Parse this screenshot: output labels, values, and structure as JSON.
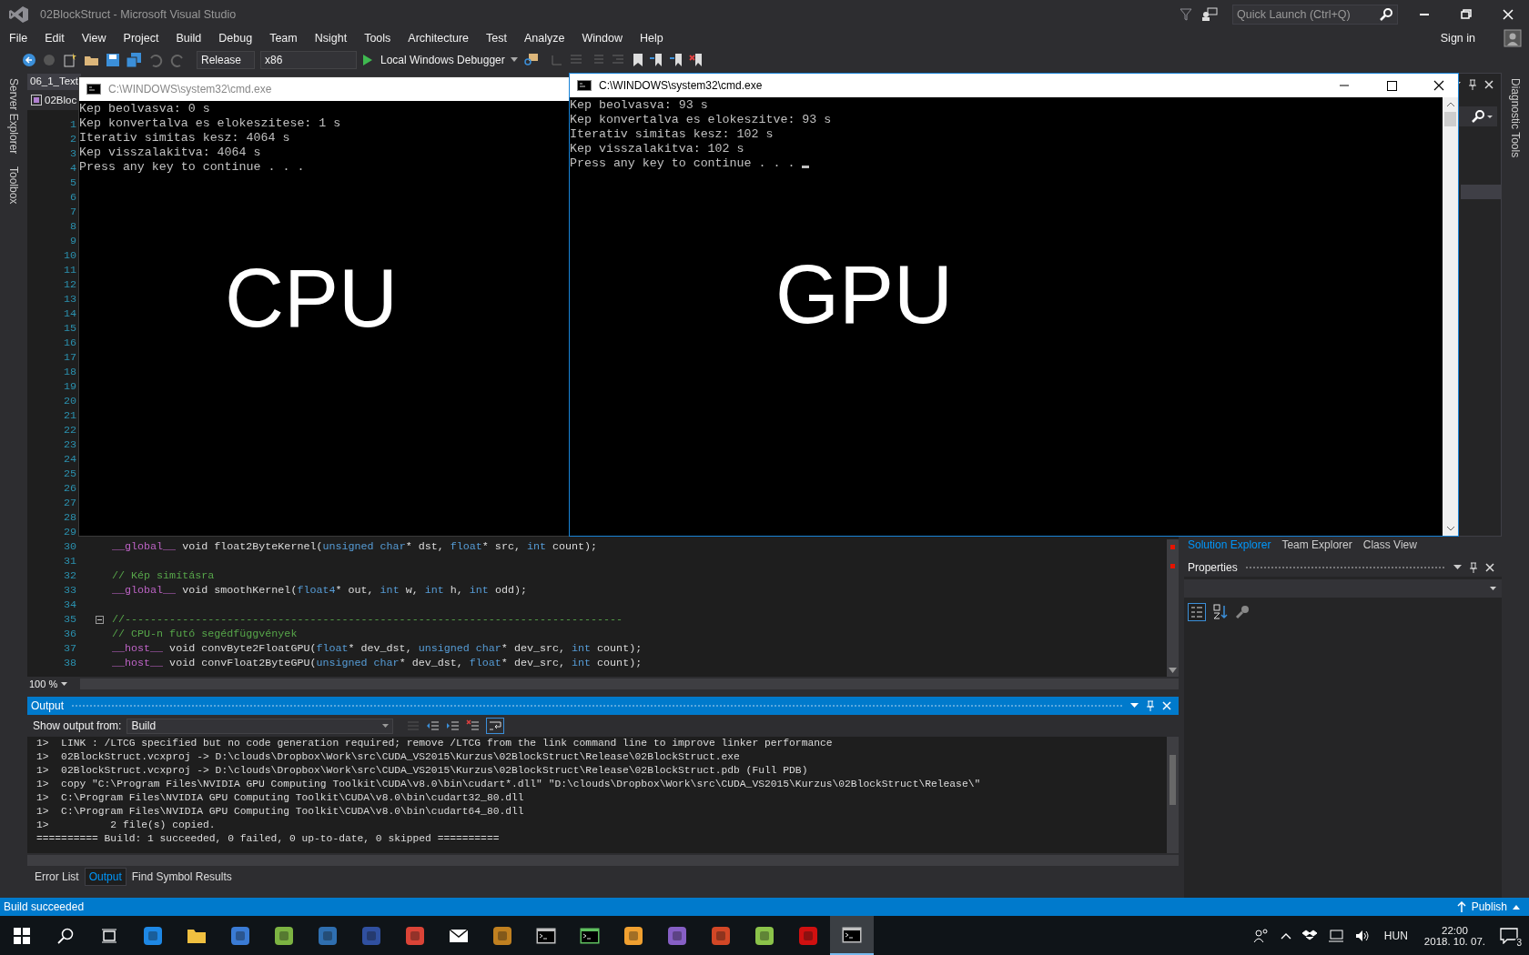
{
  "window": {
    "title": "02BlockStruct - Microsoft Visual Studio"
  },
  "quick_launch": {
    "placeholder": "Quick Launch (Ctrl+Q)"
  },
  "sign_in": "Sign in",
  "menu": [
    "File",
    "Edit",
    "View",
    "Project",
    "Build",
    "Debug",
    "Team",
    "Nsight",
    "Tools",
    "Architecture",
    "Test",
    "Analyze",
    "Window",
    "Help"
  ],
  "toolbar": {
    "configuration": "Release",
    "platform": "x86",
    "debugger": "Local Windows Debugger"
  },
  "left_strip": [
    "Server Explorer",
    "Toolbox"
  ],
  "right_strip": [
    "Diagnostic Tools"
  ],
  "editor": {
    "tab": "06_1_Text",
    "scope": "02Bloc",
    "zoom": "100 %",
    "lines": [
      {
        "number": "1",
        "kind": "code"
      },
      {
        "number": "2",
        "kind": "code"
      },
      {
        "number": "3",
        "kind": "code"
      },
      {
        "number": "4",
        "kind": "code"
      },
      {
        "number": "5",
        "kind": "code"
      },
      {
        "number": "6",
        "kind": "code"
      },
      {
        "number": "7",
        "kind": "code"
      },
      {
        "number": "8",
        "kind": "code"
      },
      {
        "number": "9",
        "kind": "code"
      },
      {
        "number": "10",
        "kind": "code"
      },
      {
        "number": "11",
        "kind": "code"
      },
      {
        "number": "12",
        "kind": "code"
      },
      {
        "number": "13",
        "kind": "code"
      },
      {
        "number": "14",
        "kind": "code"
      },
      {
        "number": "15",
        "kind": "code"
      },
      {
        "number": "16",
        "kind": "code"
      },
      {
        "number": "17",
        "kind": "code"
      },
      {
        "number": "18",
        "kind": "code"
      },
      {
        "number": "19",
        "kind": "code"
      },
      {
        "number": "20",
        "kind": "code"
      },
      {
        "number": "21",
        "kind": "code"
      },
      {
        "number": "22",
        "kind": "code"
      },
      {
        "number": "23",
        "kind": "code"
      },
      {
        "number": "24",
        "kind": "code"
      },
      {
        "number": "25",
        "kind": "code"
      },
      {
        "number": "26",
        "kind": "code"
      },
      {
        "number": "27",
        "kind": "code"
      },
      {
        "number": "28",
        "kind": "code"
      },
      {
        "number": "29",
        "kind": "code"
      },
      {
        "number": "30",
        "kind": "code",
        "tokens": [
          {
            "text": "__global__",
            "kind": "macro"
          },
          {
            "text": " void float2ByteKernel(",
            "kind": "plain"
          },
          {
            "text": "unsigned char",
            "kind": "keyword"
          },
          {
            "text": "* dst, ",
            "kind": "plain"
          },
          {
            "text": "float",
            "kind": "keyword"
          },
          {
            "text": "* src, ",
            "kind": "plain"
          },
          {
            "text": "int",
            "kind": "keyword"
          },
          {
            "text": " count);",
            "kind": "plain"
          }
        ]
      },
      {
        "number": "31",
        "kind": "code"
      },
      {
        "number": "32",
        "kind": "code",
        "tokens": [
          {
            "text": "// Kép simításra",
            "kind": "comment"
          }
        ]
      },
      {
        "number": "33",
        "kind": "code",
        "tokens": [
          {
            "text": "__global__",
            "kind": "macro"
          },
          {
            "text": " void smoothKernel(",
            "kind": "plain"
          },
          {
            "text": "float4",
            "kind": "keyword"
          },
          {
            "text": "* out, ",
            "kind": "plain"
          },
          {
            "text": "int",
            "kind": "keyword"
          },
          {
            "text": " w, ",
            "kind": "plain"
          },
          {
            "text": "int",
            "kind": "keyword"
          },
          {
            "text": " h, ",
            "kind": "plain"
          },
          {
            "text": "int",
            "kind": "keyword"
          },
          {
            "text": " odd);",
            "kind": "plain"
          }
        ]
      },
      {
        "number": "34",
        "kind": "code"
      },
      {
        "number": "35",
        "kind": "fold",
        "expanded": true,
        "tokens": [
          {
            "text": "//------------------------------------------------------------------------------",
            "kind": "comment"
          }
        ]
      },
      {
        "number": "36",
        "kind": "code",
        "tokens": [
          {
            "text": "// CPU-n futó segédfüggvények",
            "kind": "comment"
          }
        ]
      },
      {
        "number": "37",
        "kind": "code",
        "tokens": [
          {
            "text": "__host__",
            "kind": "macro"
          },
          {
            "text": " void convByte2FloatGPU(",
            "kind": "plain"
          },
          {
            "text": "float",
            "kind": "keyword"
          },
          {
            "text": "* dev_dst, ",
            "kind": "plain"
          },
          {
            "text": "unsigned char",
            "kind": "keyword"
          },
          {
            "text": "* dev_src, ",
            "kind": "plain"
          },
          {
            "text": "int",
            "kind": "keyword"
          },
          {
            "text": " count);",
            "kind": "plain"
          }
        ]
      },
      {
        "number": "38",
        "kind": "code",
        "tokens": [
          {
            "text": "__host__",
            "kind": "macro"
          },
          {
            "text": " void convFloat2ByteGPU(",
            "kind": "plain"
          },
          {
            "text": "unsigned char",
            "kind": "keyword"
          },
          {
            "text": "* dev_dst, ",
            "kind": "plain"
          },
          {
            "text": "float",
            "kind": "keyword"
          },
          {
            "text": "* dev_src, ",
            "kind": "plain"
          },
          {
            "text": "int",
            "kind": "keyword"
          },
          {
            "text": " count);",
            "kind": "plain"
          }
        ]
      }
    ]
  },
  "output": {
    "title": "Output",
    "source_label": "Show output from:",
    "source": "Build",
    "lines": [
      "1>  LINK : /LTCG specified but no code generation required; remove /LTCG from the link command line to improve linker performance",
      "1>  02BlockStruct.vcxproj -> D:\\clouds\\Dropbox\\Work\\src\\CUDA_VS2015\\Kurzus\\02BlockStruct\\Release\\02BlockStruct.exe",
      "1>  02BlockStruct.vcxproj -> D:\\clouds\\Dropbox\\Work\\src\\CUDA_VS2015\\Kurzus\\02BlockStruct\\Release\\02BlockStruct.pdb (Full PDB)",
      "1>  copy \"C:\\Program Files\\NVIDIA GPU Computing Toolkit\\CUDA\\v8.0\\bin\\cudart*.dll\" \"D:\\clouds\\Dropbox\\Work\\src\\CUDA_VS2015\\Kurzus\\02BlockStruct\\Release\\\"",
      "1>  C:\\Program Files\\NVIDIA GPU Computing Toolkit\\CUDA\\v8.0\\bin\\cudart32_80.dll",
      "1>  C:\\Program Files\\NVIDIA GPU Computing Toolkit\\CUDA\\v8.0\\bin\\cudart64_80.dll",
      "1>          2 file(s) copied.",
      "========== Build: 1 succeeded, 0 failed, 0 up-to-date, 0 skipped =========="
    ],
    "tabs": [
      {
        "label": "Error List",
        "selected": false
      },
      {
        "label": "Output",
        "selected": true
      },
      {
        "label": "Find Symbol Results",
        "selected": false
      }
    ]
  },
  "solution_tabs": [
    {
      "label": "Solution Explorer",
      "selected": true
    },
    {
      "label": "Team Explorer",
      "selected": false
    },
    {
      "label": "Class View",
      "selected": false
    }
  ],
  "properties": {
    "title": "Properties"
  },
  "status_bar": {
    "text": "Build succeeded",
    "publish": "Publish"
  },
  "consoles": [
    {
      "title": "C:\\WINDOWS\\system32\\cmd.exe",
      "active": false,
      "cursor": false,
      "label": "CPU",
      "lines": [
        "Kep beolvasva: 0 s",
        "Kep konvertalva es elokeszitese: 1 s",
        "Iterativ simitas kesz: 4064 s",
        "Kep visszalakitva: 4064 s",
        "Press any key to continue . . ."
      ]
    },
    {
      "title": "C:\\WINDOWS\\system32\\cmd.exe",
      "active": true,
      "cursor": true,
      "label": "GPU",
      "lines": [
        "Kep beolvasva: 93 s",
        "Kep konvertalva es elokeszitve: 93 s",
        "Iterativ simitas kesz: 102 s",
        "Kep visszalakitva: 102 s",
        "Press any key to continue . . . "
      ]
    }
  ],
  "taskbar": {
    "apps": [
      {
        "kind": "start",
        "selected": false
      },
      {
        "kind": "search",
        "selected": false
      },
      {
        "kind": "taskview",
        "selected": false
      },
      {
        "kind": "app",
        "color": "#1e88e5",
        "selected": false
      },
      {
        "kind": "folder",
        "color": "#f0c040",
        "selected": false
      },
      {
        "kind": "app",
        "color": "#3a7bd5",
        "selected": false
      },
      {
        "kind": "app",
        "color": "#7cb342",
        "selected": false
      },
      {
        "kind": "app",
        "color": "#2f6fb0",
        "selected": false
      },
      {
        "kind": "app",
        "color": "#3050a0",
        "selected": false
      },
      {
        "kind": "app",
        "color": "#db4437",
        "selected": false
      },
      {
        "kind": "envelope",
        "color": "#ffffff",
        "selected": false
      },
      {
        "kind": "app",
        "color": "#c08020",
        "selected": false
      },
      {
        "kind": "console",
        "color": "#c0c0c0",
        "selected": false
      },
      {
        "kind": "console",
        "color": "#5fbf5f",
        "selected": false
      },
      {
        "kind": "app",
        "color": "#f0a030",
        "selected": false
      },
      {
        "kind": "app",
        "color": "#865fc5",
        "selected": false
      },
      {
        "kind": "app",
        "color": "#d24726",
        "selected": false
      },
      {
        "kind": "app",
        "color": "#8bc34a",
        "selected": false
      },
      {
        "kind": "app",
        "color": "#d01010",
        "selected": false
      },
      {
        "kind": "console",
        "color": "#c0c0c0",
        "selected": true
      }
    ],
    "language": "HUN",
    "time": "22:00",
    "date": "2018. 10. 07.",
    "notifications": "3"
  }
}
